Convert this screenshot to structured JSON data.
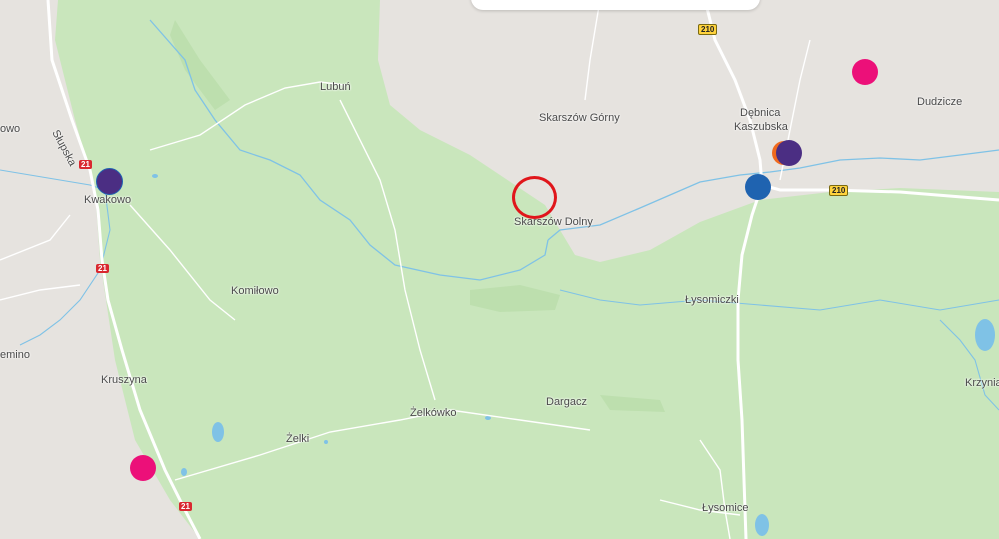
{
  "places": {
    "lubun": "Lubuń",
    "skarszow_gorny": "Skarszów Górny",
    "debnica_line1": "Dębnica",
    "debnica_line2": "Kaszubska",
    "dudzicze": "Dudzicze",
    "slupska": "Słupska",
    "owo": "owo",
    "kwakowo": "Kwakowo",
    "skarszow_dolny": "Skarszów Dolny",
    "lysomiczki": "Łysomiczki",
    "komilowo": "Komiłowo",
    "emino": "emino",
    "kruszyna": "Kruszyna",
    "dargacz": "Dargacz",
    "zelkowko": "Żelkówko",
    "zelki": "Żelki",
    "krzynia": "Krzynia",
    "lysomice": "Łysomice"
  },
  "road_shields": {
    "r210_north": "210",
    "r210_east": "210",
    "r21_kwakowo": "21",
    "r21_mid": "21",
    "r21_south": "21"
  },
  "colors": {
    "land": "#e6e3df",
    "forest": "#c9e6bc",
    "water": "#7fc2e6",
    "road": "#ffffff",
    "highlight_circle": "#e0161b",
    "marker_pink": "#ec1079",
    "marker_purple": "#4b2e83",
    "marker_blue": "#1f63b0",
    "marker_orange": "#f06a1e"
  },
  "markers": [
    {
      "name": "pink-marker",
      "color": "#ec1079"
    },
    {
      "name": "purple-marker",
      "color": "#4b2e83"
    },
    {
      "name": "blue-marker",
      "color": "#1f63b0"
    },
    {
      "name": "orange-marker",
      "color": "#f06a1e"
    }
  ]
}
